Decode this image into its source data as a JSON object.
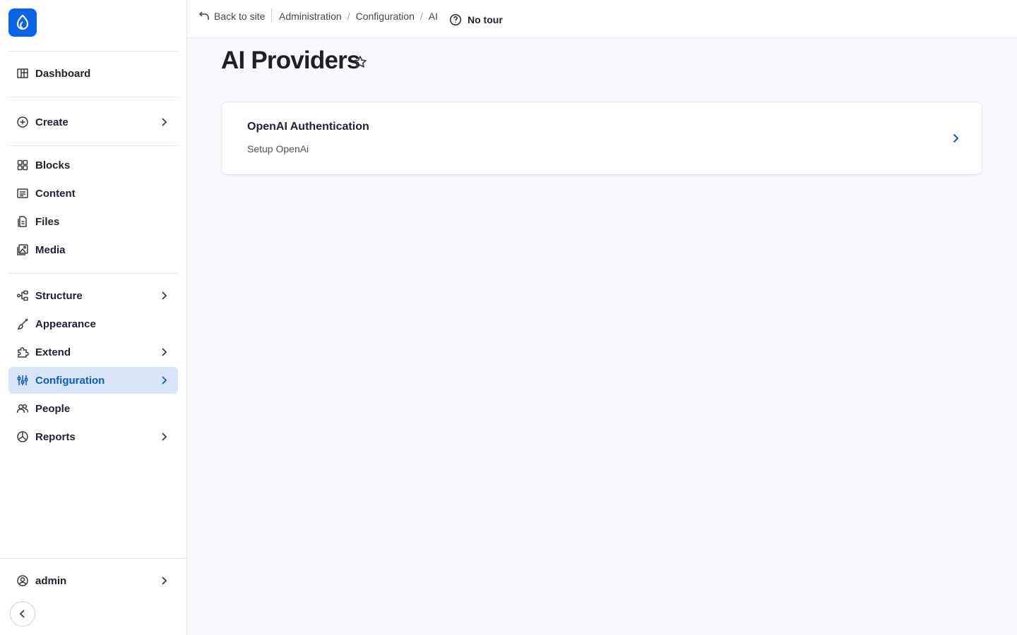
{
  "sidebar": {
    "logo_icon": "drupal-drop-icon",
    "items": [
      {
        "id": "dashboard",
        "label": "Dashboard",
        "icon": "dashboard-icon",
        "has_children": false,
        "active": false
      },
      {
        "id": "create",
        "label": "Create",
        "icon": "plus-circle-icon",
        "has_children": true,
        "active": false
      },
      {
        "id": "blocks",
        "label": "Blocks",
        "icon": "blocks-icon",
        "has_children": false,
        "active": false
      },
      {
        "id": "content",
        "label": "Content",
        "icon": "content-icon",
        "has_children": false,
        "active": false
      },
      {
        "id": "files",
        "label": "Files",
        "icon": "files-icon",
        "has_children": false,
        "active": false
      },
      {
        "id": "media",
        "label": "Media",
        "icon": "media-icon",
        "has_children": false,
        "active": false
      },
      {
        "id": "structure",
        "label": "Structure",
        "icon": "structure-icon",
        "has_children": true,
        "active": false
      },
      {
        "id": "appearance",
        "label": "Appearance",
        "icon": "brush-icon",
        "has_children": false,
        "active": false
      },
      {
        "id": "extend",
        "label": "Extend",
        "icon": "puzzle-icon",
        "has_children": true,
        "active": false
      },
      {
        "id": "configuration",
        "label": "Configuration",
        "icon": "sliders-icon",
        "has_children": true,
        "active": true
      },
      {
        "id": "people",
        "label": "People",
        "icon": "people-icon",
        "has_children": false,
        "active": false
      },
      {
        "id": "reports",
        "label": "Reports",
        "icon": "reports-icon",
        "has_children": true,
        "active": false
      }
    ],
    "user": {
      "label": "admin",
      "icon": "user-circle-icon"
    },
    "collapse_icon": "chevron-left-icon"
  },
  "topbar": {
    "back_label": "Back to site",
    "breadcrumb": [
      "Administration",
      "Configuration",
      "AI"
    ],
    "tour_label": "No tour"
  },
  "page": {
    "title": "AI Providers"
  },
  "cards": [
    {
      "title": "OpenAI Authentication",
      "description": "Setup OpenAi"
    }
  ],
  "colors": {
    "accent": "#0b63e6",
    "active_bg": "#d9e4f9",
    "active_text": "#0b5cc8",
    "page_bg": "#f7f9fd"
  }
}
